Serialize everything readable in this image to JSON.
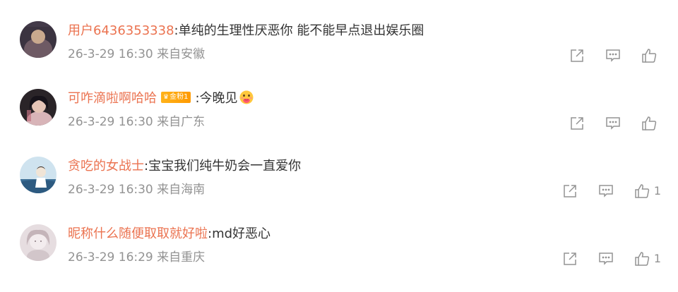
{
  "comments": [
    {
      "username": "用户6436353338",
      "separator": ":",
      "text": "单纯的生理性厌恶你 能不能早点退出娱乐圈",
      "time": "26-3-29 16:30",
      "location": "来自安徽",
      "like_count": "",
      "badge": null,
      "emoji": null,
      "avatar_colors": [
        "#5b4a5a",
        "#c6a58a",
        "#2f2a3a"
      ]
    },
    {
      "username": "可咋滴啦啊哈哈",
      "separator": ":",
      "text": "今晚见",
      "time": "26-3-29 16:30",
      "location": "来自广东",
      "like_count": "",
      "badge": "金粉1",
      "emoji": "face-with-hand-over-mouth",
      "avatar_colors": [
        "#4a3e44",
        "#e3c0b5",
        "#1d1a20"
      ]
    },
    {
      "username": "贪吃的女战士",
      "separator": ":",
      "text": "宝宝我们纯牛奶会一直爱你",
      "time": "26-3-29 16:30",
      "location": "来自海南",
      "like_count": "1",
      "badge": null,
      "emoji": null,
      "avatar_colors": [
        "#bcd8ea",
        "#4a7ea6",
        "#e9e2d8"
      ]
    },
    {
      "username": "昵称什么随便取取就好啦",
      "separator": ":",
      "text": "md好恶心",
      "time": "26-3-29 16:29",
      "location": "来自重庆",
      "like_count": "1",
      "badge": null,
      "emoji": null,
      "avatar_colors": [
        "#ddd3d6",
        "#b9a9ae",
        "#f1ecee"
      ]
    }
  ],
  "icons": {
    "share": "share-icon",
    "comment": "comment-icon",
    "like": "like-icon"
  },
  "colors": {
    "username": "#eb7350",
    "text": "#333333",
    "meta": "#939393",
    "badge": "#ffa500"
  }
}
